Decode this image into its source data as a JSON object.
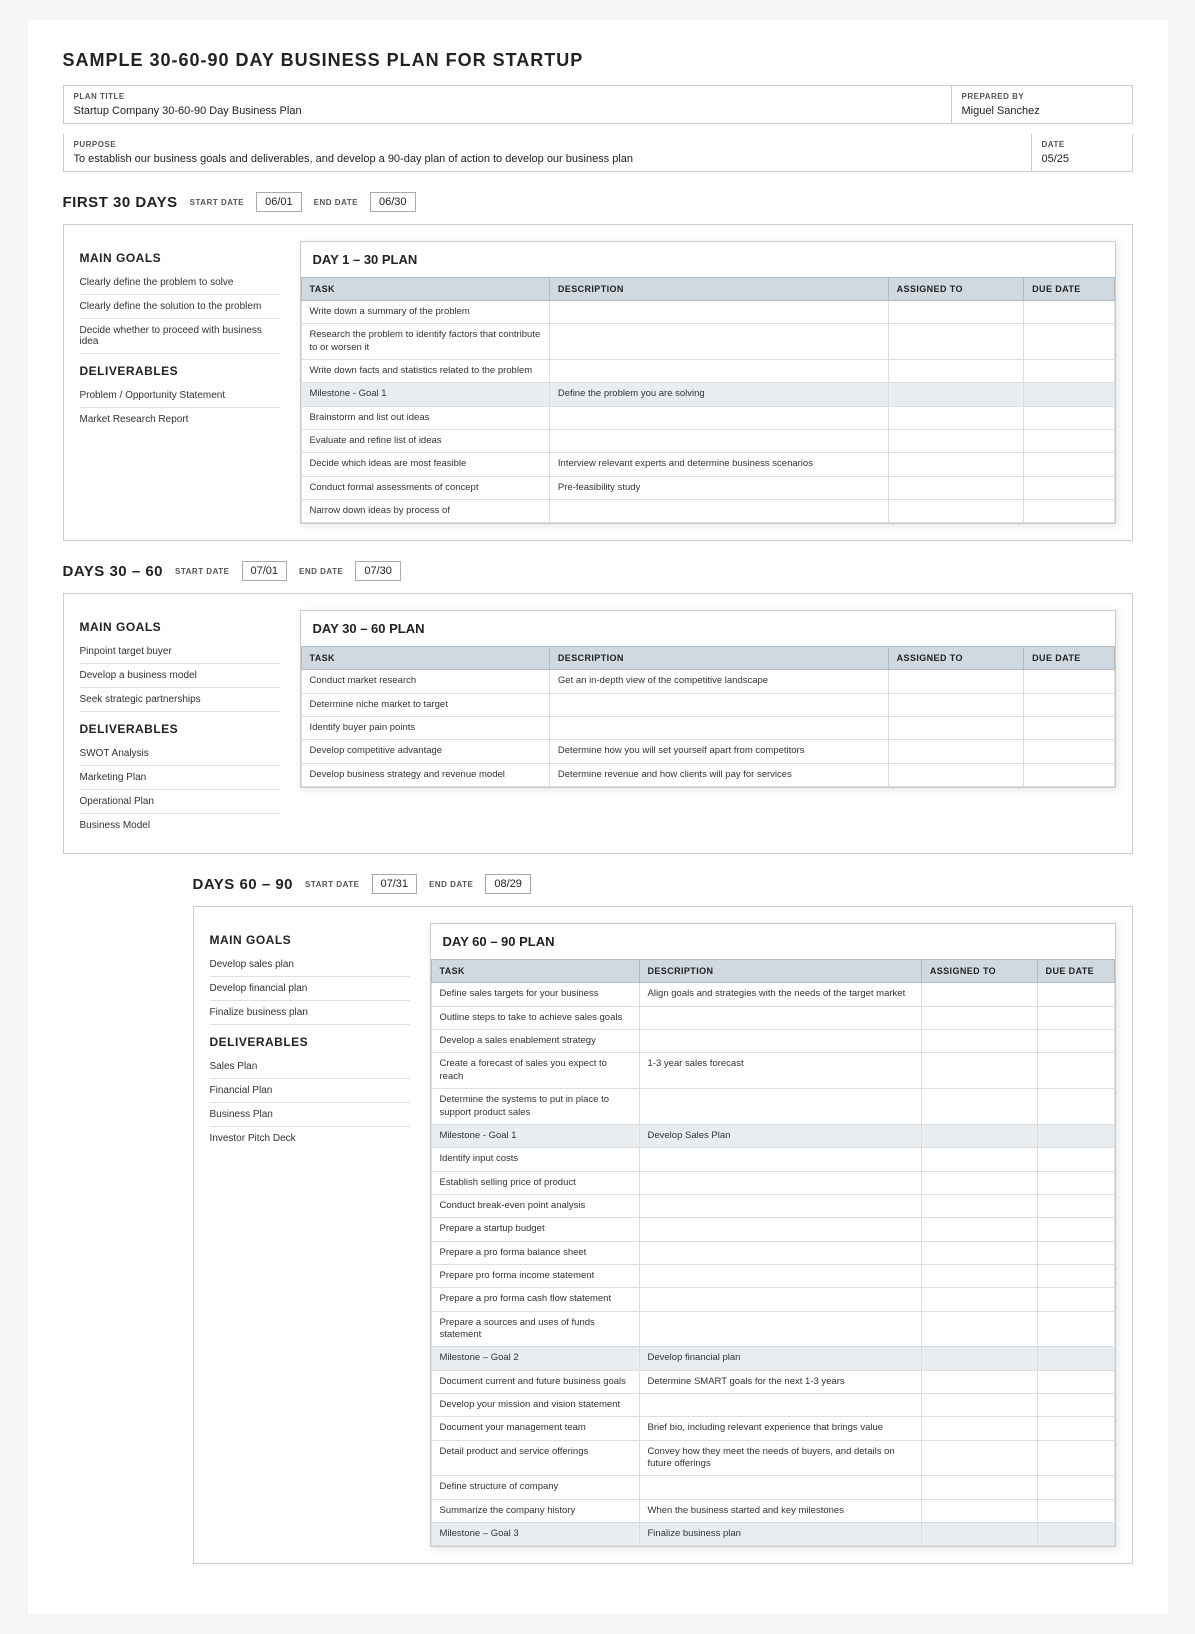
{
  "title": "SAMPLE 30-60-90 DAY BUSINESS PLAN FOR STARTUP",
  "header": {
    "plan_title_label": "PLAN TITLE",
    "plan_title_value": "Startup Company 30-60-90 Day Business Plan",
    "prepared_by_label": "PREPARED BY",
    "prepared_by_value": "Miguel Sanchez",
    "purpose_label": "PURPOSE",
    "purpose_value": "To establish our business goals and deliverables, and develop a 90-day plan of action to develop our business plan",
    "date_label": "DATE",
    "date_value": "05/25"
  },
  "first30": {
    "section_title": "FIRST 30 DAYS",
    "start_date_label": "START DATE",
    "start_date": "06/01",
    "end_date_label": "END DATE",
    "end_date": "06/30",
    "main_goals_title": "MAIN GOALS",
    "goals": [
      "Clearly define the problem to solve",
      "Clearly define the solution to the problem",
      "Decide whether to proceed with business idea"
    ],
    "deliverables_title": "DELIVERABLES",
    "deliverables": [
      "Problem / Opportunity Statement",
      "Market Research Report"
    ],
    "plan_title": "DAY 1 – 30 PLAN",
    "table_headers": [
      "TASK",
      "DESCRIPTION",
      "ASSIGNED TO",
      "DUE DATE"
    ],
    "table_rows": [
      {
        "task": "Write down a summary of the problem",
        "description": "",
        "assigned": "",
        "due": ""
      },
      {
        "task": "Research the problem to identify factors that contribute to or worsen it",
        "description": "",
        "assigned": "",
        "due": ""
      },
      {
        "task": "Write down facts and statistics related to the problem",
        "description": "",
        "assigned": "",
        "due": ""
      },
      {
        "task": "Milestone - Goal 1",
        "description": "Define the problem you are solving",
        "assigned": "",
        "due": "",
        "milestone": true
      },
      {
        "task": "Brainstorm and list out ideas",
        "description": "",
        "assigned": "",
        "due": ""
      },
      {
        "task": "Evaluate and refine list of ideas",
        "description": "",
        "assigned": "",
        "due": ""
      },
      {
        "task": "Decide which ideas are most feasible",
        "description": "Interview relevant experts and determine business scenarios",
        "assigned": "",
        "due": ""
      },
      {
        "task": "Conduct formal assessments of concept",
        "description": "Pre-feasibility study",
        "assigned": "",
        "due": ""
      },
      {
        "task": "Narrow down ideas by process of",
        "description": "",
        "assigned": "",
        "due": ""
      }
    ]
  },
  "days3060": {
    "section_title": "DAYS 30 – 60",
    "start_date_label": "START DATE",
    "start_date": "07/01",
    "end_date_label": "END DATE",
    "end_date": "07/30",
    "main_goals_title": "MAIN GOALS",
    "goals": [
      "Pinpoint target buyer",
      "Develop a business model",
      "Seek strategic partnerships"
    ],
    "deliverables_title": "DELIVERABLES",
    "deliverables": [
      "SWOT Analysis",
      "Marketing Plan",
      "Operational Plan",
      "Business Model"
    ],
    "plan_title": "DAY 30 – 60 PLAN",
    "table_headers": [
      "TASK",
      "DESCRIPTION",
      "ASSIGNED TO",
      "DUE DATE"
    ],
    "table_rows": [
      {
        "task": "Conduct market research",
        "description": "Get an in-depth view of the competitive landscape",
        "assigned": "",
        "due": ""
      },
      {
        "task": "Determine niche market to target",
        "description": "",
        "assigned": "",
        "due": ""
      },
      {
        "task": "Identify buyer pain points",
        "description": "",
        "assigned": "",
        "due": ""
      },
      {
        "task": "Develop competitive advantage",
        "description": "Determine how you will set yourself apart from competitors",
        "assigned": "",
        "due": ""
      },
      {
        "task": "Develop business strategy and revenue model",
        "description": "Determine revenue and how clients will pay for services",
        "assigned": "",
        "due": ""
      }
    ]
  },
  "days6090": {
    "section_title": "DAYS 60 – 90",
    "start_date_label": "START DATE",
    "start_date": "07/31",
    "end_date_label": "END DATE",
    "end_date": "08/29",
    "main_goals_title": "MAIN GOALS",
    "goals": [
      "Develop sales plan",
      "Develop financial plan",
      "Finalize business plan"
    ],
    "deliverables_title": "DELIVERABLES",
    "deliverables": [
      "Sales Plan",
      "Financial Plan",
      "Business Plan",
      "Investor Pitch Deck"
    ],
    "plan_title": "DAY 60 – 90 PLAN",
    "table_headers": [
      "TASK",
      "DESCRIPTION",
      "ASSIGNED TO",
      "DUE DATE"
    ],
    "table_rows": [
      {
        "task": "Define sales targets for your business",
        "description": "Align goals and strategies with the needs of the target market",
        "assigned": "",
        "due": ""
      },
      {
        "task": "Outline steps to take to achieve sales goals",
        "description": "",
        "assigned": "",
        "due": ""
      },
      {
        "task": "Develop a sales enablement strategy",
        "description": "",
        "assigned": "",
        "due": ""
      },
      {
        "task": "Create a forecast of sales you expect to reach",
        "description": "1-3 year sales forecast",
        "assigned": "",
        "due": ""
      },
      {
        "task": "Determine the systems to put in place to support product sales",
        "description": "",
        "assigned": "",
        "due": ""
      },
      {
        "task": "Milestone - Goal 1",
        "description": "Develop Sales Plan",
        "assigned": "",
        "due": "",
        "milestone": true
      },
      {
        "task": "Identify input costs",
        "description": "",
        "assigned": "",
        "due": ""
      },
      {
        "task": "Establish selling price of product",
        "description": "",
        "assigned": "",
        "due": ""
      },
      {
        "task": "Conduct break-even point analysis",
        "description": "",
        "assigned": "",
        "due": ""
      },
      {
        "task": "Prepare a startup budget",
        "description": "",
        "assigned": "",
        "due": ""
      },
      {
        "task": "Prepare a pro forma balance sheet",
        "description": "",
        "assigned": "",
        "due": ""
      },
      {
        "task": "Prepare pro forma income statement",
        "description": "",
        "assigned": "",
        "due": ""
      },
      {
        "task": "Prepare a pro forma cash flow statement",
        "description": "",
        "assigned": "",
        "due": ""
      },
      {
        "task": "Prepare a sources and uses of funds statement",
        "description": "",
        "assigned": "",
        "due": ""
      },
      {
        "task": "Milestone – Goal 2",
        "description": "Develop financial plan",
        "assigned": "",
        "due": "",
        "milestone": true
      },
      {
        "task": "Document current and future business goals",
        "description": "Determine SMART goals for the next 1-3 years",
        "assigned": "",
        "due": ""
      },
      {
        "task": "Develop your mission and vision statement",
        "description": "",
        "assigned": "",
        "due": ""
      },
      {
        "task": "Document your management team",
        "description": "Brief bio, including relevant experience that brings value",
        "assigned": "",
        "due": ""
      },
      {
        "task": "Detail product and service offerings",
        "description": "Convey how they meet the needs of buyers, and details on future offerings",
        "assigned": "",
        "due": ""
      },
      {
        "task": "Define structure of company",
        "description": "",
        "assigned": "",
        "due": ""
      },
      {
        "task": "Summarize the company history",
        "description": "When the business started and key milestones",
        "assigned": "",
        "due": ""
      },
      {
        "task": "Milestone – Goal 3",
        "description": "Finalize business plan",
        "assigned": "",
        "due": "",
        "milestone": true
      }
    ]
  }
}
